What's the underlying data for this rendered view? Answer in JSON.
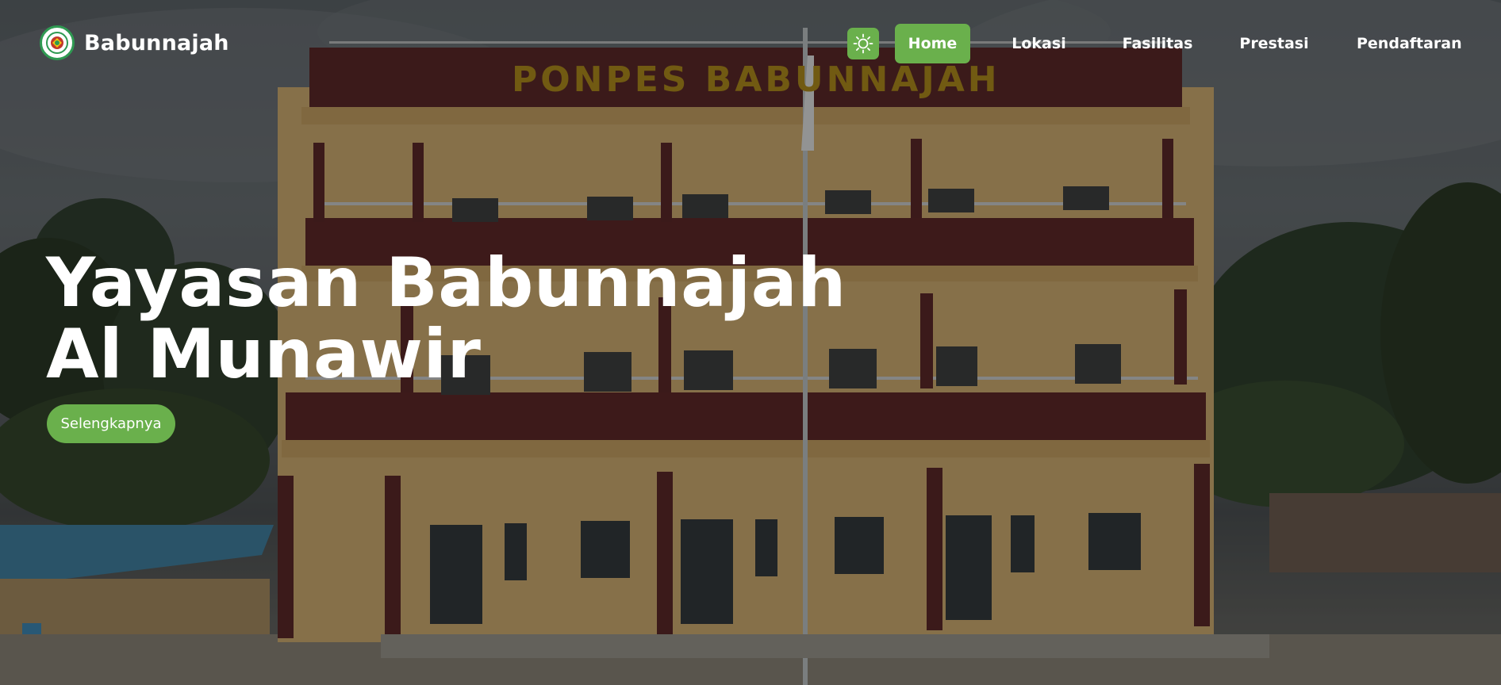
{
  "brand": {
    "name": "Babunnajah",
    "logo_icon": "school-crest-icon"
  },
  "nav": {
    "theme_toggle_icon": "sun-icon",
    "items": [
      {
        "label": "Home",
        "active": true
      },
      {
        "label": "Lokasi",
        "active": false
      },
      {
        "label": "Fasilitas",
        "active": false
      },
      {
        "label": "Prestasi",
        "active": false
      },
      {
        "label": "Pendaftaran",
        "active": false
      }
    ]
  },
  "hero": {
    "title_line1": "Yayasan Babunnajah",
    "title_line2": "Al Munawir",
    "cta_label": "Selengkapnya",
    "building_sign": "PONPES BABUNNAJAH"
  },
  "colors": {
    "accent": "#6ab04c",
    "logo_ring": "#2f9a52",
    "text": "#ffffff"
  }
}
